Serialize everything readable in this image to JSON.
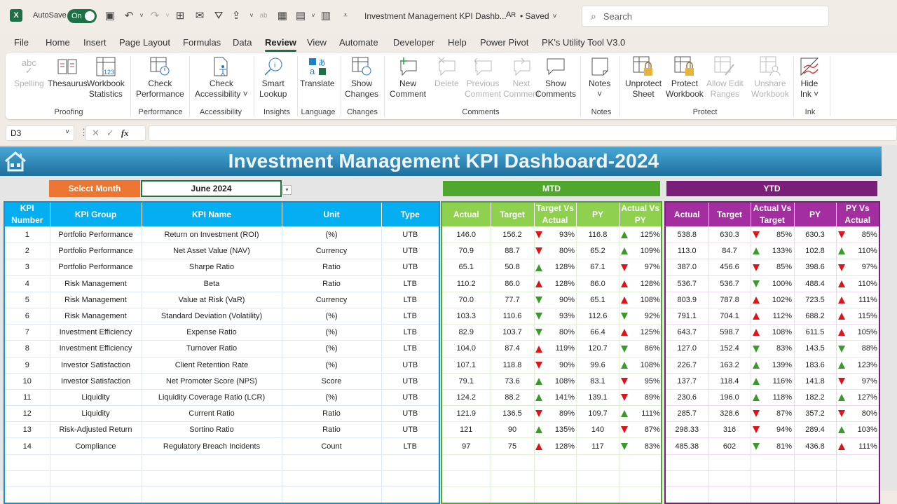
{
  "titlebar": {
    "app_icon": "excel-logo-icon",
    "autosave_label": "AutoSave",
    "autosave_state": "On",
    "doc_title": "Investment Management KPI Dashb...",
    "saved_status": "• Saved",
    "search_placeholder": "Search"
  },
  "menu": {
    "tabs": [
      "File",
      "Home",
      "Insert",
      "Page Layout",
      "Formulas",
      "Data",
      "Review",
      "View",
      "Automate",
      "Developer",
      "Help",
      "Power Pivot",
      "PK's Utility Tool V3.0"
    ],
    "active": "Review"
  },
  "ribbon": {
    "buttons": [
      {
        "l1": "Spelling",
        "l2": "",
        "icon": "spelling-icon",
        "disabled": true
      },
      {
        "l1": "Thesaurus",
        "l2": "",
        "icon": "thesaurus-icon",
        "disabled": false
      },
      {
        "l1": "Workbook",
        "l2": "Statistics",
        "icon": "workbook-statistics-icon",
        "disabled": false
      },
      {
        "l1": "Check",
        "l2": "Performance",
        "icon": "check-performance-icon",
        "disabled": false
      },
      {
        "l1": "Check",
        "l2": "Accessibility ˅",
        "icon": "check-accessibility-icon",
        "disabled": false
      },
      {
        "l1": "Smart",
        "l2": "Lookup",
        "icon": "smart-lookup-icon",
        "disabled": false
      },
      {
        "l1": "Translate",
        "l2": "",
        "icon": "translate-icon",
        "disabled": false
      },
      {
        "l1": "Show",
        "l2": "Changes",
        "icon": "show-changes-icon",
        "disabled": false
      },
      {
        "l1": "New",
        "l2": "Comment",
        "icon": "new-comment-icon",
        "disabled": false
      },
      {
        "l1": "Delete",
        "l2": "",
        "icon": "delete-comment-icon",
        "disabled": true
      },
      {
        "l1": "Previous",
        "l2": "Comment",
        "icon": "previous-comment-icon",
        "disabled": true
      },
      {
        "l1": "Next",
        "l2": "Comment",
        "icon": "next-comment-icon",
        "disabled": true
      },
      {
        "l1": "Show",
        "l2": "Comments",
        "icon": "show-comments-icon",
        "disabled": false
      },
      {
        "l1": "Notes",
        "l2": "˅",
        "icon": "notes-icon",
        "disabled": false
      },
      {
        "l1": "Unprotect",
        "l2": "Sheet",
        "icon": "unprotect-sheet-icon",
        "disabled": false
      },
      {
        "l1": "Protect",
        "l2": "Workbook",
        "icon": "protect-workbook-icon",
        "disabled": false
      },
      {
        "l1": "Allow Edit",
        "l2": "Ranges",
        "icon": "allow-edit-ranges-icon",
        "disabled": true
      },
      {
        "l1": "Unshare",
        "l2": "Workbook",
        "icon": "unshare-workbook-icon",
        "disabled": true
      },
      {
        "l1": "Hide",
        "l2": "Ink ˅",
        "icon": "hide-ink-icon",
        "disabled": false
      }
    ],
    "groups": [
      "Proofing",
      "Performance",
      "Accessibility",
      "Insights",
      "Language",
      "Changes",
      "Comments",
      "Notes",
      "Protect",
      "Ink"
    ]
  },
  "formula_bar": {
    "name_box": "D3",
    "formula": ""
  },
  "dashboard": {
    "title": "Investment Management KPI Dashboard-2024",
    "select_month_label": "Select Month",
    "selected_month": "June 2024",
    "mtd_label": "MTD",
    "ytd_label": "YTD",
    "info_headers": [
      "KPI Number",
      "KPI Group",
      "KPI Name",
      "Unit",
      "Type"
    ],
    "mtd_headers": [
      "Actual",
      "Target",
      "Target Vs Actual",
      "PY",
      "Actual Vs PY"
    ],
    "ytd_headers": [
      "Actual",
      "Target",
      "Actual Vs Target",
      "PY",
      "PY Vs Actual"
    ],
    "colors": {
      "up_good": "#3b9a2c",
      "bad": "#e0121a",
      "mtd": "#4fa72d",
      "ytd": "#7a1f78",
      "info": "#05aef0",
      "select": "#ec7532"
    },
    "rows": [
      {
        "num": "1",
        "group": "Portfolio Performance",
        "name": "Return on Investment (ROI)",
        "unit": "(%)",
        "type": "UTB",
        "mtd": {
          "actual": "146.0",
          "target": "156.2",
          "tva": "93%",
          "tva_dir": "down",
          "tva_col": "red",
          "py": "116.8",
          "avp": "125%",
          "avp_dir": "up",
          "avp_col": "green"
        },
        "ytd": {
          "actual": "538.8",
          "target": "630.3",
          "avt": "85%",
          "avt_dir": "down",
          "avt_col": "red",
          "py": "630.3",
          "pva": "85%",
          "pva_dir": "down",
          "pva_col": "red"
        }
      },
      {
        "num": "2",
        "group": "Portfolio Performance",
        "name": "Net Asset Value (NAV)",
        "unit": "Currency",
        "type": "UTB",
        "mtd": {
          "actual": "70.9",
          "target": "88.7",
          "tva": "80%",
          "tva_dir": "down",
          "tva_col": "red",
          "py": "65.2",
          "avp": "109%",
          "avp_dir": "up",
          "avp_col": "green"
        },
        "ytd": {
          "actual": "113.0",
          "target": "84.7",
          "avt": "133%",
          "avt_dir": "up",
          "avt_col": "green",
          "py": "102.8",
          "pva": "110%",
          "pva_dir": "up",
          "pva_col": "green"
        }
      },
      {
        "num": "3",
        "group": "Portfolio Performance",
        "name": "Sharpe Ratio",
        "unit": "Ratio",
        "type": "UTB",
        "mtd": {
          "actual": "65.1",
          "target": "50.8",
          "tva": "128%",
          "tva_dir": "up",
          "tva_col": "green",
          "py": "67.1",
          "avp": "97%",
          "avp_dir": "down",
          "avp_col": "red"
        },
        "ytd": {
          "actual": "387.0",
          "target": "456.6",
          "avt": "85%",
          "avt_dir": "down",
          "avt_col": "red",
          "py": "398.6",
          "pva": "97%",
          "pva_dir": "down",
          "pva_col": "red"
        }
      },
      {
        "num": "4",
        "group": "Risk Management",
        "name": "Beta",
        "unit": "Ratio",
        "type": "LTB",
        "mtd": {
          "actual": "110.2",
          "target": "86.0",
          "tva": "128%",
          "tva_dir": "up",
          "tva_col": "red",
          "py": "86.0",
          "avp": "128%",
          "avp_dir": "up",
          "avp_col": "red"
        },
        "ytd": {
          "actual": "536.7",
          "target": "536.7",
          "avt": "100%",
          "avt_dir": "down",
          "avt_col": "green",
          "py": "488.4",
          "pva": "110%",
          "pva_dir": "up",
          "pva_col": "red"
        }
      },
      {
        "num": "5",
        "group": "Risk Management",
        "name": "Value at Risk (VaR)",
        "unit": "Currency",
        "type": "LTB",
        "mtd": {
          "actual": "70.0",
          "target": "77.7",
          "tva": "90%",
          "tva_dir": "down",
          "tva_col": "green",
          "py": "65.1",
          "avp": "108%",
          "avp_dir": "up",
          "avp_col": "red"
        },
        "ytd": {
          "actual": "803.9",
          "target": "787.8",
          "avt": "102%",
          "avt_dir": "up",
          "avt_col": "red",
          "py": "723.5",
          "pva": "111%",
          "pva_dir": "up",
          "pva_col": "red"
        }
      },
      {
        "num": "6",
        "group": "Risk Management",
        "name": "Standard Deviation (Volatility)",
        "unit": "(%)",
        "type": "LTB",
        "mtd": {
          "actual": "103.3",
          "target": "110.6",
          "tva": "93%",
          "tva_dir": "down",
          "tva_col": "green",
          "py": "112.6",
          "avp": "92%",
          "avp_dir": "down",
          "avp_col": "green"
        },
        "ytd": {
          "actual": "791.1",
          "target": "704.1",
          "avt": "112%",
          "avt_dir": "up",
          "avt_col": "red",
          "py": "688.2",
          "pva": "115%",
          "pva_dir": "up",
          "pva_col": "red"
        }
      },
      {
        "num": "7",
        "group": "Investment Efficiency",
        "name": "Expense Ratio",
        "unit": "(%)",
        "type": "LTB",
        "mtd": {
          "actual": "82.9",
          "target": "103.7",
          "tva": "80%",
          "tva_dir": "down",
          "tva_col": "green",
          "py": "66.4",
          "avp": "125%",
          "avp_dir": "up",
          "avp_col": "red"
        },
        "ytd": {
          "actual": "643.7",
          "target": "598.7",
          "avt": "108%",
          "avt_dir": "up",
          "avt_col": "red",
          "py": "611.5",
          "pva": "105%",
          "pva_dir": "up",
          "pva_col": "red"
        }
      },
      {
        "num": "8",
        "group": "Investment Efficiency",
        "name": "Turnover Ratio",
        "unit": "(%)",
        "type": "LTB",
        "mtd": {
          "actual": "104.0",
          "target": "87.4",
          "tva": "119%",
          "tva_dir": "up",
          "tva_col": "red",
          "py": "120.7",
          "avp": "86%",
          "avp_dir": "down",
          "avp_col": "green"
        },
        "ytd": {
          "actual": "127.0",
          "target": "152.4",
          "avt": "83%",
          "avt_dir": "down",
          "avt_col": "green",
          "py": "143.5",
          "pva": "88%",
          "pva_dir": "down",
          "pva_col": "green"
        }
      },
      {
        "num": "9",
        "group": "Investor Satisfaction",
        "name": "Client Retention Rate",
        "unit": "(%)",
        "type": "UTB",
        "mtd": {
          "actual": "107.1",
          "target": "118.8",
          "tva": "90%",
          "tva_dir": "down",
          "tva_col": "red",
          "py": "99.6",
          "avp": "108%",
          "avp_dir": "up",
          "avp_col": "green"
        },
        "ytd": {
          "actual": "226.7",
          "target": "163.2",
          "avt": "139%",
          "avt_dir": "up",
          "avt_col": "green",
          "py": "183.6",
          "pva": "123%",
          "pva_dir": "up",
          "pva_col": "green"
        }
      },
      {
        "num": "10",
        "group": "Investor Satisfaction",
        "name": "Net Promoter Score (NPS)",
        "unit": "Score",
        "type": "UTB",
        "mtd": {
          "actual": "79.1",
          "target": "73.6",
          "tva": "108%",
          "tva_dir": "up",
          "tva_col": "green",
          "py": "83.1",
          "avp": "95%",
          "avp_dir": "down",
          "avp_col": "red"
        },
        "ytd": {
          "actual": "137.7",
          "target": "118.4",
          "avt": "116%",
          "avt_dir": "up",
          "avt_col": "green",
          "py": "141.8",
          "pva": "97%",
          "pva_dir": "down",
          "pva_col": "red"
        }
      },
      {
        "num": "11",
        "group": "Liquidity",
        "name": "Liquidity Coverage Ratio (LCR)",
        "unit": "(%)",
        "type": "UTB",
        "mtd": {
          "actual": "124.2",
          "target": "88.2",
          "tva": "141%",
          "tva_dir": "up",
          "tva_col": "green",
          "py": "139.1",
          "avp": "89%",
          "avp_dir": "down",
          "avp_col": "red"
        },
        "ytd": {
          "actual": "230.6",
          "target": "196.0",
          "avt": "118%",
          "avt_dir": "up",
          "avt_col": "green",
          "py": "182.2",
          "pva": "127%",
          "pva_dir": "up",
          "pva_col": "green"
        }
      },
      {
        "num": "12",
        "group": "Liquidity",
        "name": "Current Ratio",
        "unit": "Ratio",
        "type": "UTB",
        "mtd": {
          "actual": "121.9",
          "target": "136.5",
          "tva": "89%",
          "tva_dir": "down",
          "tva_col": "red",
          "py": "109.7",
          "avp": "111%",
          "avp_dir": "up",
          "avp_col": "green"
        },
        "ytd": {
          "actual": "285.7",
          "target": "328.6",
          "avt": "87%",
          "avt_dir": "down",
          "avt_col": "red",
          "py": "357.2",
          "pva": "80%",
          "pva_dir": "down",
          "pva_col": "red"
        }
      },
      {
        "num": "13",
        "group": "Risk-Adjusted Return",
        "name": "Sortino Ratio",
        "unit": "Ratio",
        "type": "UTB",
        "mtd": {
          "actual": "121",
          "target": "90",
          "tva": "135%",
          "tva_dir": "up",
          "tva_col": "green",
          "py": "140",
          "avp": "87%",
          "avp_dir": "down",
          "avp_col": "red"
        },
        "ytd": {
          "actual": "298.33",
          "target": "316",
          "avt": "94%",
          "avt_dir": "down",
          "avt_col": "red",
          "py": "289.4",
          "pva": "103%",
          "pva_dir": "up",
          "pva_col": "green"
        }
      },
      {
        "num": "14",
        "group": "Compliance",
        "name": "Regulatory Breach Incidents",
        "unit": "Count",
        "type": "LTB",
        "mtd": {
          "actual": "97",
          "target": "75",
          "tva": "128%",
          "tva_dir": "up",
          "tva_col": "red",
          "py": "117",
          "avp": "83%",
          "avp_dir": "down",
          "avp_col": "green"
        },
        "ytd": {
          "actual": "485.38",
          "target": "602",
          "avt": "81%",
          "avt_dir": "down",
          "avt_col": "green",
          "py": "436.8",
          "pva": "111%",
          "pva_dir": "up",
          "pva_col": "red"
        }
      }
    ],
    "empty_rows": 3
  }
}
